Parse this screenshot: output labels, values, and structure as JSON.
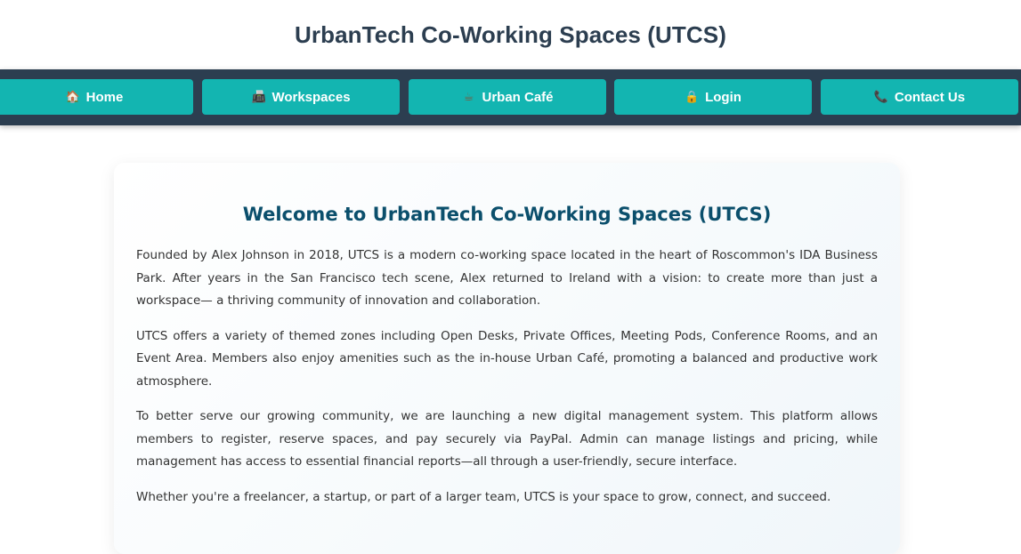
{
  "header": {
    "title": "UrbanTech Co-Working Spaces (UTCS)"
  },
  "nav": {
    "items": [
      {
        "icon": "house-icon",
        "glyph": "🏠",
        "label": "Home"
      },
      {
        "icon": "phone-booth-icon",
        "glyph": "📠",
        "label": "Workspaces"
      },
      {
        "icon": "coffee-icon",
        "glyph": "☕",
        "label": "Urban Café"
      },
      {
        "icon": "lock-icon",
        "glyph": "🔒",
        "label": "Login"
      },
      {
        "icon": "phone-icon",
        "glyph": "📞",
        "label": "Contact Us"
      }
    ]
  },
  "main": {
    "heading": "Welcome to UrbanTech Co-Working Spaces (UTCS)",
    "paragraphs": [
      "Founded by Alex Johnson in 2018, UTCS is a modern co-working space located in the heart of Roscommon's IDA Business Park. After years in the San Francisco tech scene, Alex returned to Ireland with a vision: to create more than just a workspace— a thriving community of innovation and collaboration.",
      "UTCS offers a variety of themed zones including Open Desks, Private Offices, Meeting Pods, Conference Rooms, and an Event Area. Members also enjoy amenities such as the in-house Urban Café, promoting a balanced and productive work atmosphere.",
      "To better serve our growing community, we are launching a new digital management system. This platform allows members to register, reserve spaces, and pay securely via PayPal. Admin can manage listings and pricing, while management has access to essential financial reports—all through a user-friendly, secure interface.",
      "Whether you're a freelancer, a startup, or part of a larger team, UTCS is your space to grow, connect, and succeed."
    ]
  },
  "colors": {
    "navbar_bg": "#2c3e50",
    "nav_button_bg": "#13b5b1",
    "title": "#2c3e50",
    "heading": "#0b4f6c"
  }
}
